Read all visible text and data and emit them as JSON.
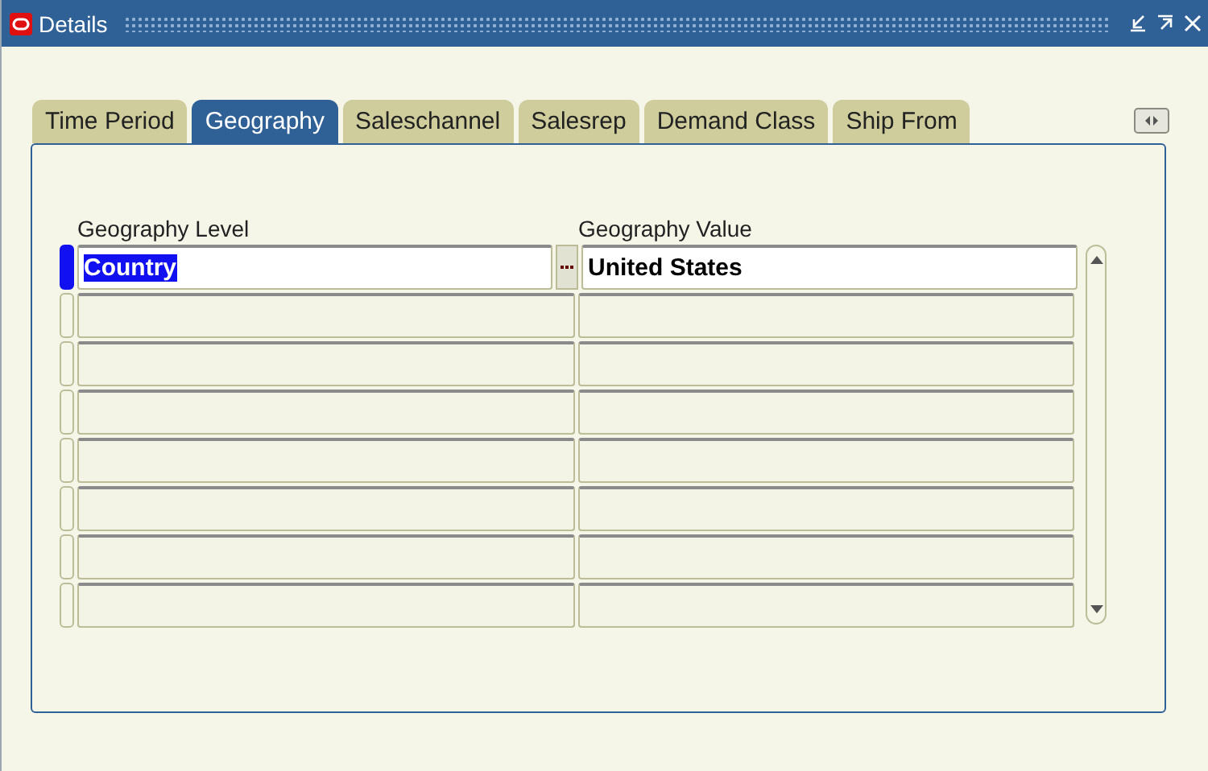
{
  "window": {
    "title": "Details"
  },
  "tabs": [
    {
      "label": "Time Period",
      "selected": false
    },
    {
      "label": "Geography",
      "selected": true
    },
    {
      "label": "Saleschannel",
      "selected": false
    },
    {
      "label": "Salesrep",
      "selected": false
    },
    {
      "label": "Demand Class",
      "selected": false
    },
    {
      "label": "Ship From",
      "selected": false
    }
  ],
  "columns": [
    "Geography Level",
    "Geography Value"
  ],
  "rows": [
    {
      "level": "Country",
      "value": "United States",
      "current": true
    },
    {
      "current": false
    },
    {
      "current": false
    },
    {
      "current": false
    },
    {
      "current": false
    },
    {
      "current": false
    },
    {
      "current": false
    },
    {
      "current": false
    }
  ]
}
